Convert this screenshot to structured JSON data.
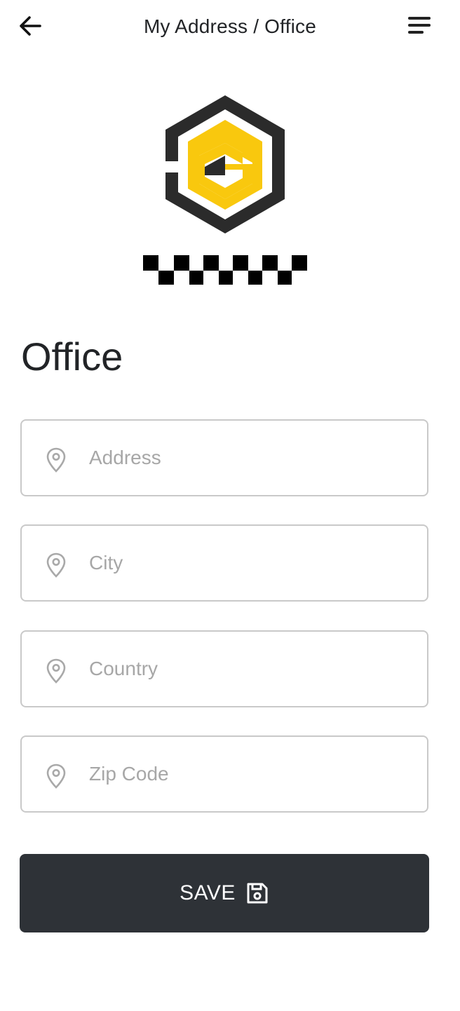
{
  "header": {
    "title": "My Address / Office",
    "back_icon": "arrow-left-icon",
    "menu_icon": "menu-icon"
  },
  "logo": {
    "icon": "hexagon-logo-icon",
    "colors": {
      "dark": "#2b2b2b",
      "accent": "#f9c80e",
      "checker": "#000000"
    }
  },
  "section": {
    "title": "Office"
  },
  "fields": {
    "address": {
      "placeholder": "Address",
      "value": "",
      "icon": "map-pin-icon"
    },
    "city": {
      "placeholder": "City",
      "value": "",
      "icon": "map-pin-icon"
    },
    "country": {
      "placeholder": "Country",
      "value": "",
      "icon": "map-pin-icon"
    },
    "zip": {
      "placeholder": "Zip Code",
      "value": "",
      "icon": "map-pin-icon"
    }
  },
  "save_button": {
    "label": "SAVE",
    "icon": "save-disk-icon",
    "background": "#2e3237"
  }
}
